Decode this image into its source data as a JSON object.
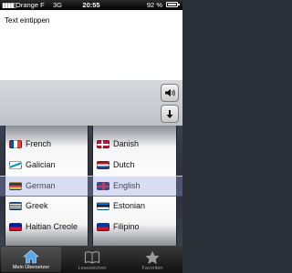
{
  "status_bar": {
    "carrier": "Orange F",
    "network": "3G",
    "time": "20:55",
    "battery": "92 %"
  },
  "input": {
    "placeholder_text": "Text eintippen"
  },
  "buttons": {
    "speaker_icon": "speaker-icon",
    "down_icon": "down-arrow-icon"
  },
  "picker": {
    "left_column": [
      {
        "label": "French",
        "flag": "fr"
      },
      {
        "label": "Galician",
        "flag": "gl"
      },
      {
        "label": "German",
        "flag": "de"
      },
      {
        "label": "Greek",
        "flag": "gr"
      },
      {
        "label": "Haitian Creole",
        "flag": "ht"
      }
    ],
    "right_column": [
      {
        "label": "Danish",
        "flag": "dk"
      },
      {
        "label": "Dutch",
        "flag": "nl"
      },
      {
        "label": "English",
        "flag": "gb"
      },
      {
        "label": "Estonian",
        "flag": "ee"
      },
      {
        "label": "Filipino",
        "flag": "ph"
      }
    ],
    "selected_left": "German",
    "selected_right": "English"
  },
  "tab_bar": {
    "tabs": [
      {
        "label": "Mein Übersetzer",
        "icon": "home-icon",
        "active": true
      },
      {
        "label": "Lesezeichen",
        "icon": "book-icon",
        "active": false
      },
      {
        "label": "Favoriten",
        "icon": "star-icon",
        "active": false
      }
    ]
  },
  "colors": {
    "status_bar": "#000000",
    "picker_background": "#2a2e38",
    "selection_tint": "#96a0dc",
    "tab_active_icon": "#5aa8e8"
  }
}
